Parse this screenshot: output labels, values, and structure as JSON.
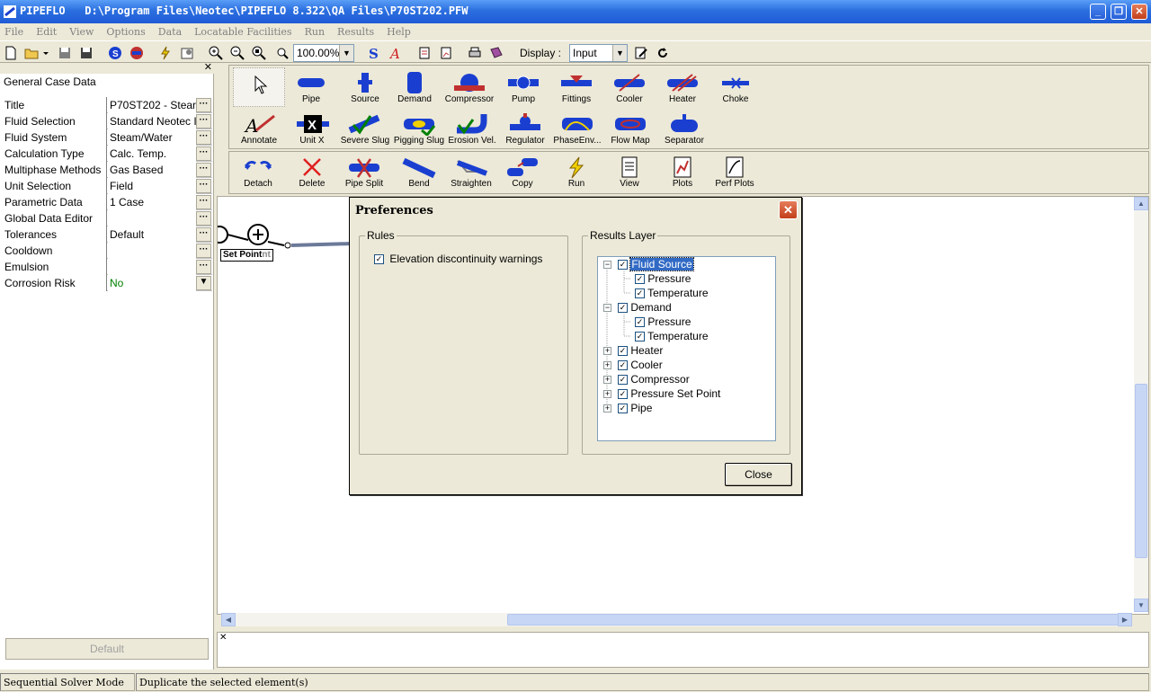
{
  "window": {
    "title": "PIPEFLO   D:\\Program Files\\Neotec\\PIPEFLO 8.322\\QA Files\\P70ST202.PFW"
  },
  "menu": [
    "File",
    "Edit",
    "View",
    "Options",
    "Data",
    "Locatable Facilities",
    "Run",
    "Results",
    "Help"
  ],
  "toolbar": {
    "zoom": "100.00%",
    "display_label": "Display :",
    "display_value": "Input"
  },
  "left_panel": {
    "header": "General Case Data",
    "properties": [
      {
        "key": "Title",
        "value": "P70ST202 - Stear"
      },
      {
        "key": "Fluid Selection",
        "value": "Standard Neotec I"
      },
      {
        "key": "Fluid System",
        "value": "Steam/Water"
      },
      {
        "key": "Calculation Type",
        "value": "Calc. Temp."
      },
      {
        "key": "Multiphase Methods",
        "value": "Gas Based"
      },
      {
        "key": "Unit Selection",
        "value": "Field"
      },
      {
        "key": "Parametric Data",
        "value": "1 Case"
      },
      {
        "key": "Global Data Editor",
        "value": ""
      },
      {
        "key": "Tolerances",
        "value": "Default"
      },
      {
        "key": "Cooldown",
        "value": ""
      },
      {
        "key": "Emulsion",
        "value": ""
      },
      {
        "key": "Corrosion Risk",
        "value": "No"
      }
    ],
    "default_button": "Default"
  },
  "palette": {
    "row1": [
      "Pipe",
      "Source",
      "Demand",
      "Compressor",
      "Pump",
      "Fittings",
      "Cooler",
      "Heater",
      "Choke"
    ],
    "row2": [
      "Annotate",
      "Unit X",
      "Severe Slug",
      "Pigging Slug",
      "Erosion Vel.",
      "Regulator",
      "PhaseEnv...",
      "Flow Map",
      "Separator"
    ],
    "row3": [
      "Detach",
      "Delete",
      "Pipe Split",
      "Bend",
      "Straighten",
      "Copy",
      "Run",
      "View",
      "Plots",
      "Perf Plots"
    ]
  },
  "canvas": {
    "label": "Set Point"
  },
  "dialog": {
    "title": "Preferences",
    "rules_label": "Rules",
    "rules_option": "Elevation discontinuity warnings",
    "results_label": "Results Layer",
    "tree": [
      {
        "label": "Fluid Source",
        "children": [
          "Pressure",
          "Temperature"
        ]
      },
      {
        "label": "Demand",
        "children": [
          "Pressure",
          "Temperature"
        ]
      },
      {
        "label": "Heater"
      },
      {
        "label": "Cooler"
      },
      {
        "label": "Compressor"
      },
      {
        "label": "Pressure Set Point"
      },
      {
        "label": "Pipe"
      }
    ],
    "close_button": "Close"
  },
  "status": {
    "mode": "Sequential Solver Mode",
    "message": "Duplicate the selected element(s)"
  },
  "colors": {
    "title_bar": "#2b6fe0",
    "pipe_blue": "#1a3fd0",
    "selection": "#316ac5",
    "green_value": "#008000"
  }
}
